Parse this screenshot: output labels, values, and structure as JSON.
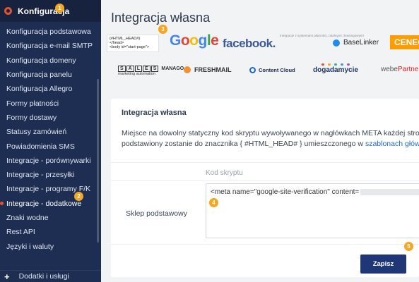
{
  "sidebar": {
    "section_title": "Konfiguracja",
    "items": [
      {
        "label": "Konfiguracja podstawowa",
        "active": false
      },
      {
        "label": "Konfiguracja e-mail SMTP",
        "active": false
      },
      {
        "label": "Konfiguracja domeny",
        "active": false
      },
      {
        "label": "Konfiguracja panelu",
        "active": false
      },
      {
        "label": "Konfiguracja Allegro",
        "active": false
      },
      {
        "label": "Formy płatności",
        "active": false
      },
      {
        "label": "Formy dostawy",
        "active": false
      },
      {
        "label": "Statusy zamówień",
        "active": false
      },
      {
        "label": "Powiadomienia SMS",
        "active": false
      },
      {
        "label": "Integracje - porównywarki",
        "active": false
      },
      {
        "label": "Integracje - przesyłki",
        "active": false
      },
      {
        "label": "Integracje - programy F/K",
        "active": false
      },
      {
        "label": "Integracje - dodatkowe",
        "active": true
      },
      {
        "label": "Znaki wodne",
        "active": false
      },
      {
        "label": "Rest API",
        "active": false
      },
      {
        "label": "Języki i waluty",
        "active": false
      }
    ],
    "bottom_label": "Dodatki i usługi",
    "bottom_icon": "plus-icon"
  },
  "badges": [
    "1",
    "2",
    "3",
    "4",
    "5"
  ],
  "main": {
    "page_title": "Integracja własna",
    "logos": {
      "html_snippet": [
        "{#HTML_HEAD#}",
        "</head>",
        "<body id=\"start-page\">"
      ],
      "google": "Google",
      "facebook": "facebook.",
      "smallint": "Integracje z systemami płatności, ratalnymi i leasingowymi",
      "baselinker": "BaseLinker",
      "ceneo": "CENEO",
      "salesmanago_boxes": [
        "S",
        "A",
        "L",
        "E",
        "S"
      ],
      "salesmanago_name": "MANAGO",
      "salesmanago_tag": "marketing automation",
      "freshmail": "FRESHMAIL",
      "contentcloud": "Content Cloud",
      "dogadamycie": "dogadamycie",
      "webepartner_prefix": "webe",
      "webepartner_main": "Partner"
    },
    "card": {
      "title": "Integracja własna",
      "desc_line1": "Miejsce na dowolny statyczny kod skryptu wywoływanego w nagłówkach META każdej strony skl",
      "desc_line2_a": "podstawiony zostanie do znacznika { #HTML_HEAD# } umieszczonego w ",
      "desc_link": "szablonach głównych sk",
      "column_header": "Kod skryptu",
      "row_label": "Sklep podstawowy",
      "code_value": "<meta name=\"google-site-verification\" content=",
      "save_label": "Zapisz"
    }
  },
  "colors": {
    "sidebar_bg": "#1e2e52",
    "accent": "#e0552f",
    "badge": "#f5a623",
    "button": "#1f3677",
    "link": "#1d6bd6"
  }
}
